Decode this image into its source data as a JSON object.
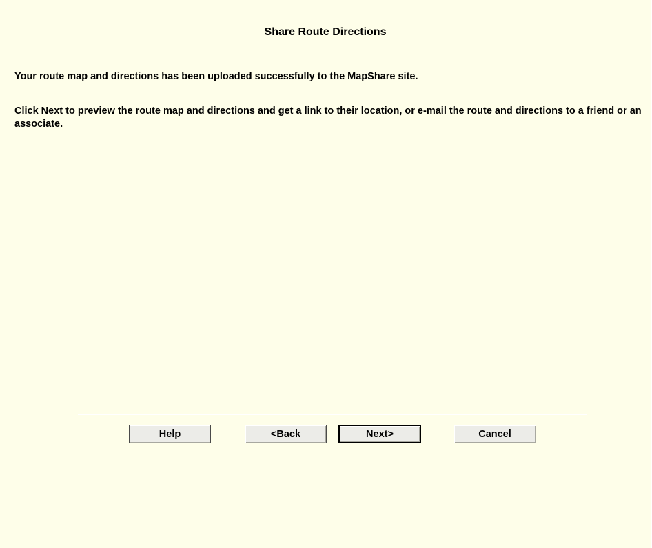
{
  "dialog": {
    "title": "Share Route Directions",
    "message_upload": "Your route map and directions has been uploaded successfully to the MapShare site.",
    "message_instructions": "Click Next to preview the route map and directions and get a link to their location, or e-mail the route and directions to a friend or an associate."
  },
  "buttons": {
    "help": "Help",
    "back": "<Back",
    "next": "Next>",
    "cancel": "Cancel"
  },
  "colors": {
    "background": "#fefee9",
    "button_face": "#ecece8",
    "text": "#000000"
  }
}
